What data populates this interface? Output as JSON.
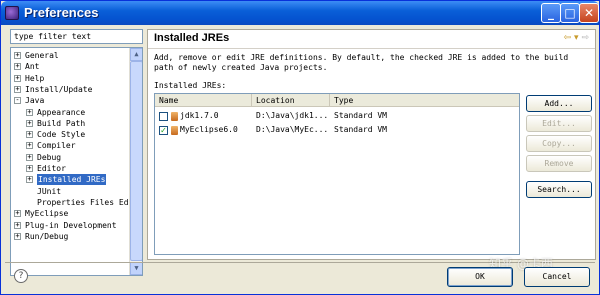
{
  "window": {
    "title": "Preferences"
  },
  "titlebar_buttons": {
    "minimize": "_",
    "maximize": "□",
    "close": "✕"
  },
  "filter": {
    "placeholder": "type filter text",
    "value": "type filter text"
  },
  "tree": [
    {
      "label": "General",
      "toggle": "+",
      "depth": 0
    },
    {
      "label": "Ant",
      "toggle": "+",
      "depth": 0
    },
    {
      "label": "Help",
      "toggle": "+",
      "depth": 0
    },
    {
      "label": "Install/Update",
      "toggle": "+",
      "depth": 0
    },
    {
      "label": "Java",
      "toggle": "-",
      "depth": 0
    },
    {
      "label": "Appearance",
      "toggle": "+",
      "depth": 1
    },
    {
      "label": "Build Path",
      "toggle": "+",
      "depth": 1
    },
    {
      "label": "Code Style",
      "toggle": "+",
      "depth": 1
    },
    {
      "label": "Compiler",
      "toggle": "+",
      "depth": 1
    },
    {
      "label": "Debug",
      "toggle": "+",
      "depth": 1
    },
    {
      "label": "Editor",
      "toggle": "+",
      "depth": 1
    },
    {
      "label": "Installed JREs",
      "toggle": "+",
      "depth": 1,
      "selected": true
    },
    {
      "label": "JUnit",
      "toggle": "",
      "depth": 1
    },
    {
      "label": "Properties Files Ed",
      "toggle": "",
      "depth": 1
    },
    {
      "label": "MyEclipse",
      "toggle": "+",
      "depth": 0
    },
    {
      "label": "Plug-in Development",
      "toggle": "+",
      "depth": 0
    },
    {
      "label": "Run/Debug",
      "toggle": "+",
      "depth": 0
    }
  ],
  "page": {
    "title": "Installed JREs",
    "nav_back": "⇦",
    "nav_menu": "▾",
    "nav_forward": "⇨",
    "description": "Add, remove or edit JRE definitions. By default, the checked JRE is added to the build path of newly created Java projects.",
    "jres_label": "Installed JREs:"
  },
  "table": {
    "columns": [
      "Name",
      "Location",
      "Type"
    ],
    "rows": [
      {
        "checked": false,
        "name": "jdk1.7.0",
        "location": "D:\\Java\\jdk1...",
        "type": "Standard VM"
      },
      {
        "checked": true,
        "name": "MyEclipse6.0",
        "location": "D:\\Java\\MyEc...",
        "type": "Standard VM"
      }
    ],
    "check_mark": "✓"
  },
  "buttons": {
    "add": "Add...",
    "edit": "Edit...",
    "copy": "Copy...",
    "remove": "Remove",
    "search": "Search...",
    "ok": "OK",
    "cancel": "Cancel"
  },
  "help_icon": "?",
  "watermark": "知乎 @卡西"
}
